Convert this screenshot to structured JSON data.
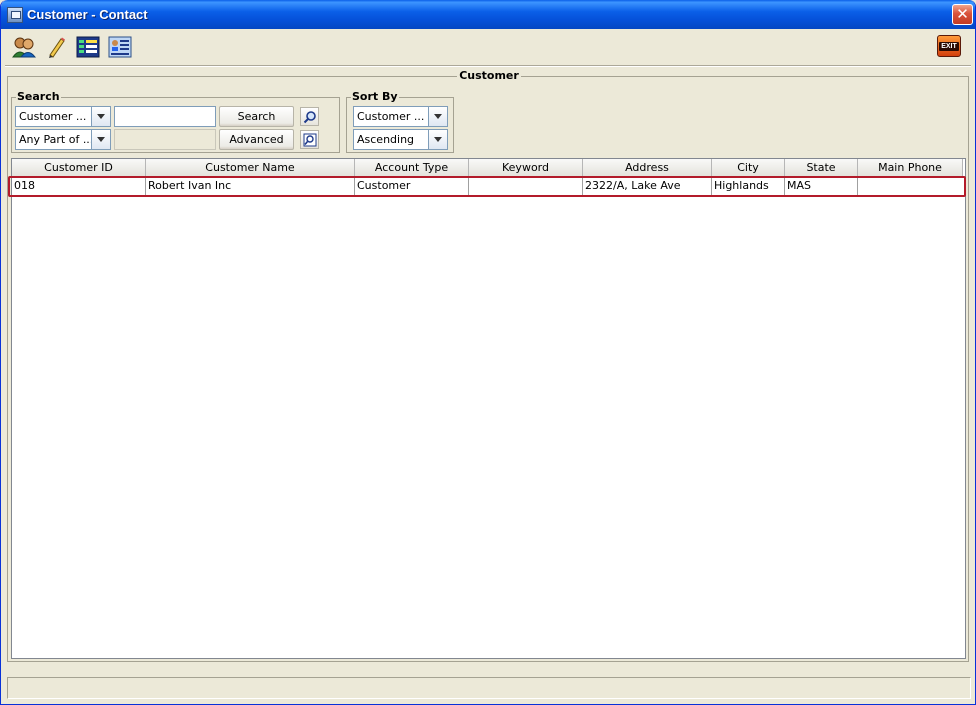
{
  "window": {
    "title": "Customer - Contact",
    "close_glyph": "✕"
  },
  "toolbar": {
    "icons": [
      "contacts-icon",
      "edit-pencil-icon",
      "report-grid-icon",
      "customer-detail-icon"
    ],
    "exit_label": "EXIT"
  },
  "panel": {
    "title": "Customer"
  },
  "search": {
    "title": "Search",
    "field_combo": "Customer ...",
    "match_combo": "Any Part of ...",
    "input_value": "",
    "search_button": "Search",
    "advanced_button": "Advanced"
  },
  "sort": {
    "title": "Sort By",
    "field_combo": "Customer ...",
    "order_combo": "Ascending"
  },
  "table": {
    "columns": [
      "Customer ID",
      "Customer Name",
      "Account Type",
      "Keyword",
      "Address",
      "City",
      "State",
      "Main Phone"
    ],
    "rows": [
      [
        "018",
        "Robert Ivan Inc",
        "Customer",
        "",
        "2322/A, Lake Ave",
        "Highlands",
        "MAS",
        ""
      ]
    ]
  },
  "status": {
    "text": ""
  }
}
